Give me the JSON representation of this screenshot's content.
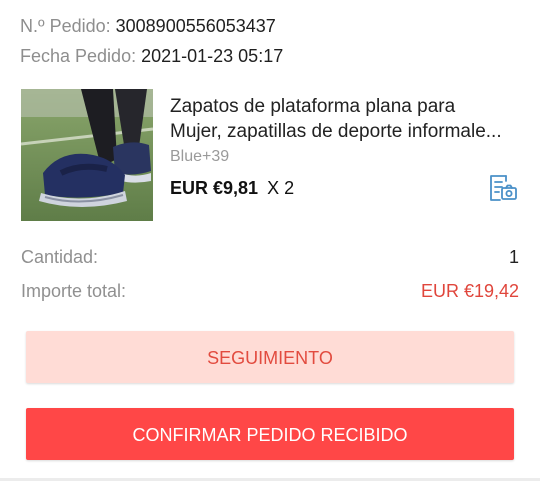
{
  "order": {
    "number_label": "N.º Pedido:",
    "number_value": "3008900556053437",
    "date_label": "Fecha Pedido:",
    "date_value": "2021-01-23 05:17"
  },
  "product": {
    "title_line1": "Zapatos de plataforma plana para",
    "title_line2": "Mujer, zapatillas de deporte informale...",
    "variant": "Blue+39",
    "price": "EUR €9,81",
    "quantity_multiplier": "X 2",
    "snapshot_icon": "receipt-camera-icon"
  },
  "summary": {
    "quantity_label": "Cantidad:",
    "quantity_value": "1",
    "total_label": "Importe total:",
    "total_value": "EUR €19,42"
  },
  "buttons": {
    "tracking": "SEGUIMIENTO",
    "confirm": "CONFIRMAR PEDIDO RECIBIDO"
  },
  "colors": {
    "accent_red": "#ff4747",
    "total_red": "#e0463c",
    "tracking_bg": "#ffdcd6",
    "icon_blue": "#4a90c8"
  }
}
